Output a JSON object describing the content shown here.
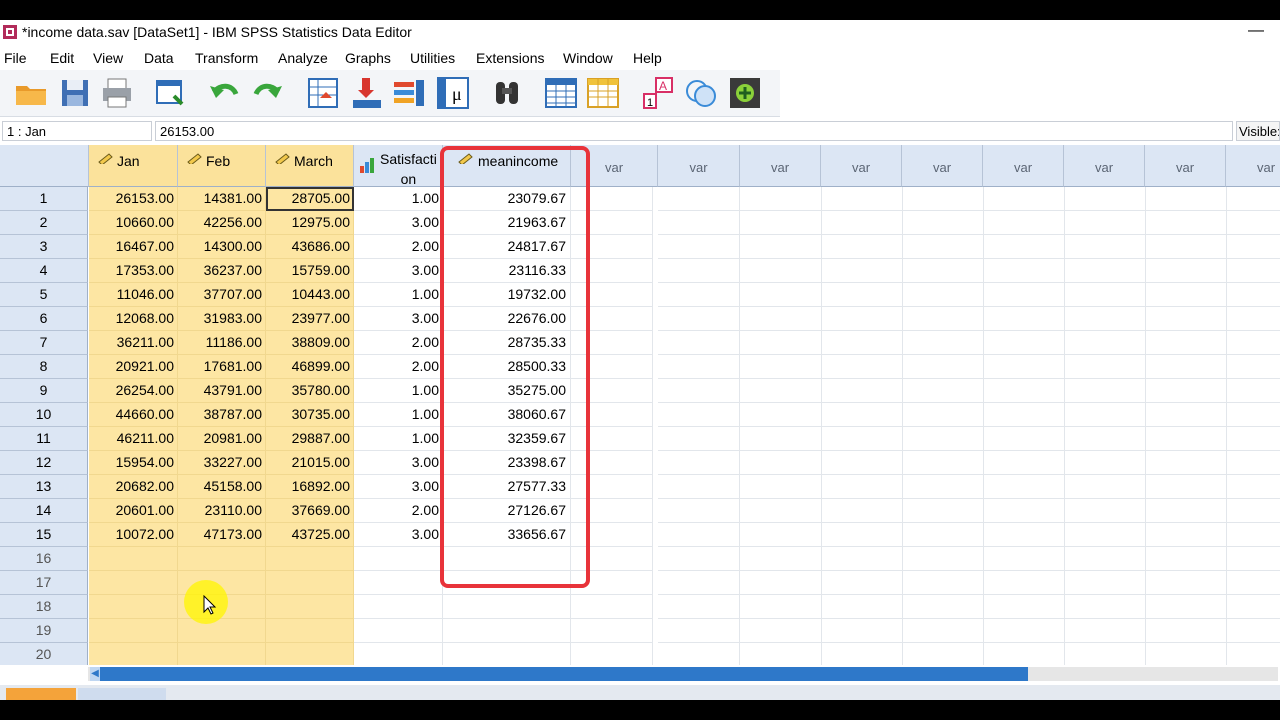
{
  "window": {
    "title": "*income data.sav [DataSet1] - IBM SPSS Statistics Data Editor",
    "minimize": "—"
  },
  "menu": [
    "File",
    "Edit",
    "View",
    "Data",
    "Transform",
    "Analyze",
    "Graphs",
    "Utilities",
    "Extensions",
    "Window",
    "Help"
  ],
  "toolbar": [
    "open-folder-icon",
    "save-icon",
    "print-icon",
    "recall-dialog-icon",
    "undo-icon",
    "redo-icon",
    "goto-case-icon",
    "goto-variable-icon",
    "variables-icon",
    "run-descriptives-icon",
    "find-icon",
    "insert-cases-icon",
    "insert-variable-icon",
    "split-file-icon",
    "value-labels-icon",
    "use-sets-icon",
    "add-ons-icon"
  ],
  "cellbar": {
    "ref": "1 : Jan",
    "value": "26153.00",
    "visible": "Visible:"
  },
  "columns": [
    "Jan",
    "Feb",
    "March",
    "Satisfacti\non",
    "meanincome"
  ],
  "var_label": "var",
  "rows": [
    [
      "26153.00",
      "14381.00",
      "28705.00",
      "1.00",
      "23079.67"
    ],
    [
      "10660.00",
      "42256.00",
      "12975.00",
      "3.00",
      "21963.67"
    ],
    [
      "16467.00",
      "14300.00",
      "43686.00",
      "2.00",
      "24817.67"
    ],
    [
      "17353.00",
      "36237.00",
      "15759.00",
      "3.00",
      "23116.33"
    ],
    [
      "11046.00",
      "37707.00",
      "10443.00",
      "1.00",
      "19732.00"
    ],
    [
      "12068.00",
      "31983.00",
      "23977.00",
      "3.00",
      "22676.00"
    ],
    [
      "36211.00",
      "11186.00",
      "38809.00",
      "2.00",
      "28735.33"
    ],
    [
      "20921.00",
      "17681.00",
      "46899.00",
      "2.00",
      "28500.33"
    ],
    [
      "26254.00",
      "43791.00",
      "35780.00",
      "1.00",
      "35275.00"
    ],
    [
      "44660.00",
      "38787.00",
      "30735.00",
      "1.00",
      "38060.67"
    ],
    [
      "46211.00",
      "20981.00",
      "29887.00",
      "1.00",
      "32359.67"
    ],
    [
      "15954.00",
      "33227.00",
      "21015.00",
      "3.00",
      "23398.67"
    ],
    [
      "20682.00",
      "45158.00",
      "16892.00",
      "3.00",
      "27577.33"
    ],
    [
      "20601.00",
      "23110.00",
      "37669.00",
      "2.00",
      "27126.67"
    ],
    [
      "10072.00",
      "47173.00",
      "43725.00",
      "3.00",
      "33656.67"
    ]
  ],
  "empty_rows": [
    "16",
    "17",
    "18",
    "19",
    "20"
  ],
  "colors": {
    "selected": "#fde6a3",
    "header": "#dce6f4",
    "highlight": "#e8333a"
  }
}
